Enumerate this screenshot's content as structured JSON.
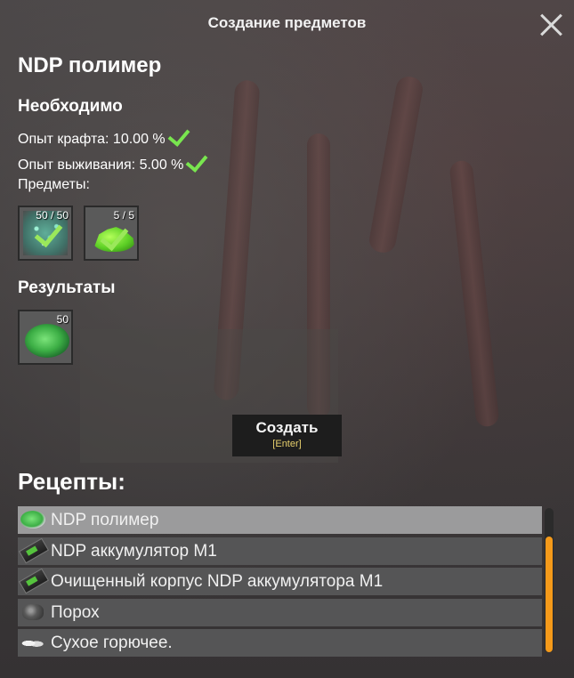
{
  "window": {
    "title": "Создание предметов"
  },
  "item": {
    "name": "NDP полимер"
  },
  "requirements": {
    "heading": "Необходимо",
    "craft_exp": "Опыт крафта: 10.00 %",
    "survival_exp": "Опыт выживания: 5.00 %",
    "items_label": "Предметы:",
    "slots": [
      {
        "count": "50 / 50",
        "icon": "crystal-dust-icon"
      },
      {
        "count": "5 / 5",
        "icon": "green-gel-icon"
      }
    ]
  },
  "results": {
    "heading": "Результаты",
    "slots": [
      {
        "count": "50",
        "icon": "ndp-polymer-icon"
      }
    ]
  },
  "create_button": {
    "label": "Создать",
    "hotkey": "[Enter]"
  },
  "recipes": {
    "heading": "Рецепты:",
    "items": [
      {
        "label": "NDP полимер",
        "icon": "ndp-polymer-icon",
        "selected": true
      },
      {
        "label": "NDP аккумулятор M1",
        "icon": "battery-icon",
        "selected": false
      },
      {
        "label": "Очищенный корпус NDP аккумулятора M1",
        "icon": "battery-case-icon",
        "selected": false
      },
      {
        "label": "Порох",
        "icon": "gunpowder-icon",
        "selected": false
      },
      {
        "label": "Сухое горючее.",
        "icon": "dry-fuel-icon",
        "selected": false
      }
    ]
  },
  "colors": {
    "accent_scroll": "#f59a1a",
    "check": "#79e64f",
    "hotkey": "#e7cf6c"
  }
}
